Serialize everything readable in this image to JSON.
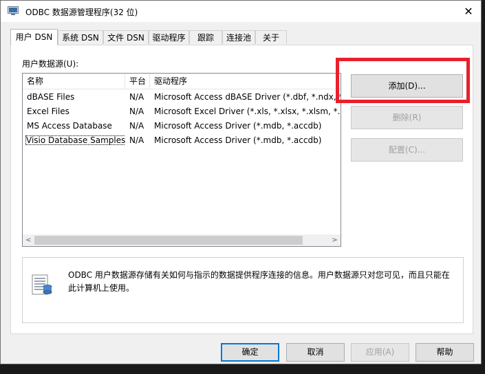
{
  "window": {
    "title": "ODBC 数据源管理程序(32 位)",
    "close_glyph": "✕"
  },
  "tabs": [
    {
      "label": "用户 DSN",
      "active": true
    },
    {
      "label": "系统 DSN"
    },
    {
      "label": "文件 DSN"
    },
    {
      "label": "驱动程序"
    },
    {
      "label": "跟踪"
    },
    {
      "label": "连接池"
    },
    {
      "label": "关于"
    }
  ],
  "user_sources": {
    "label": "用户数据源(U):",
    "columns": [
      "名称",
      "平台",
      "驱动程序"
    ],
    "rows": [
      {
        "name": "dBASE Files",
        "platform": "N/A",
        "driver": "Microsoft Access dBASE Driver (*.dbf, *.ndx, *.mdx)"
      },
      {
        "name": "Excel Files",
        "platform": "N/A",
        "driver": "Microsoft Excel Driver (*.xls, *.xlsx, *.xlsm, *.xlsb)"
      },
      {
        "name": "MS Access Database",
        "platform": "N/A",
        "driver": "Microsoft Access Driver (*.mdb, *.accdb)"
      },
      {
        "name": "Visio Database Samples",
        "platform": "N/A",
        "driver": "Microsoft Access Driver (*.mdb, *.accdb)"
      }
    ],
    "scroll_left": "<",
    "scroll_right": ">"
  },
  "actions": {
    "add": "添加(D)...",
    "remove": "删除(R)",
    "configure": "配置(C)..."
  },
  "info": {
    "text": "ODBC 用户数据源存储有关如何与指示的数据提供程序连接的信息。用户数据源只对您可见，而且只能在此计算机上使用。",
    "icon": "data-source-icon"
  },
  "footer": {
    "ok": "确定",
    "cancel": "取消",
    "apply": "应用(A)",
    "help": "帮助"
  },
  "colors": {
    "highlight": "#e8202a",
    "focus": "#0078d7"
  }
}
